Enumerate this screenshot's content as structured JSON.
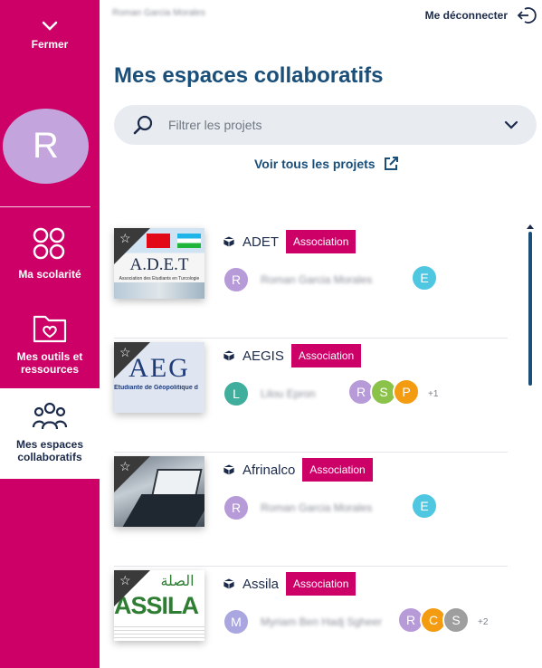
{
  "sidebar": {
    "close_label": "Fermer",
    "avatar_letter": "R",
    "nav": [
      {
        "label": "Ma scolarité",
        "icon": "grid-icon"
      },
      {
        "label": "Mes outils et ressources",
        "icon": "folder-heart-icon"
      },
      {
        "label": "Mes espaces collaboratifs",
        "icon": "people-icon",
        "active": true
      }
    ],
    "color": "#cc0066"
  },
  "topbar": {
    "user_name": "Roman Garcia Morales",
    "logout_label": "Me déconnecter"
  },
  "main": {
    "title": "Mes espaces collaboratifs",
    "filter_placeholder": "Filtrer les projets",
    "see_all_label": "Voir tous les projets"
  },
  "projects": [
    {
      "name": "ADET",
      "tag": "Association",
      "thumb_text": "A.D.E.T",
      "thumb_sub": "Association des Etudiants en Turcologie",
      "members": [
        {
          "letter": "R",
          "color": "#b79ad8",
          "name": "Roman Garcia Morales"
        },
        {
          "letter": "E",
          "color": "#4fc7e0"
        }
      ],
      "more": ""
    },
    {
      "name": "AEGIS",
      "tag": "Association",
      "thumb_text": "AEG",
      "thumb_sub": "Étudiante de Géopolitique d",
      "members": [
        {
          "letter": "L",
          "color": "#3fae9c",
          "name": "Lilou Epron"
        },
        {
          "letter": "R",
          "color": "#b79ad8"
        },
        {
          "letter": "S",
          "color": "#8bc34a"
        },
        {
          "letter": "P",
          "color": "#f39c12"
        }
      ],
      "more": "+1"
    },
    {
      "name": "Afrinalco",
      "tag": "Association",
      "thumb_text": "",
      "thumb_sub": "",
      "members": [
        {
          "letter": "R",
          "color": "#b79ad8",
          "name": "Roman Garcia Morales"
        },
        {
          "letter": "E",
          "color": "#4fc7e0"
        }
      ],
      "more": ""
    },
    {
      "name": "Assila",
      "tag": "Association",
      "thumb_text": "ASSILA",
      "thumb_sub": "الصلة",
      "members": [
        {
          "letter": "M",
          "color": "#a9a6e0",
          "name": "Myriam Ben Hadj Sgheer"
        },
        {
          "letter": "R",
          "color": "#b79ad8"
        },
        {
          "letter": "C",
          "color": "#f39c12"
        },
        {
          "letter": "S",
          "color": "#9e9e9e"
        }
      ],
      "more": "+2"
    }
  ]
}
